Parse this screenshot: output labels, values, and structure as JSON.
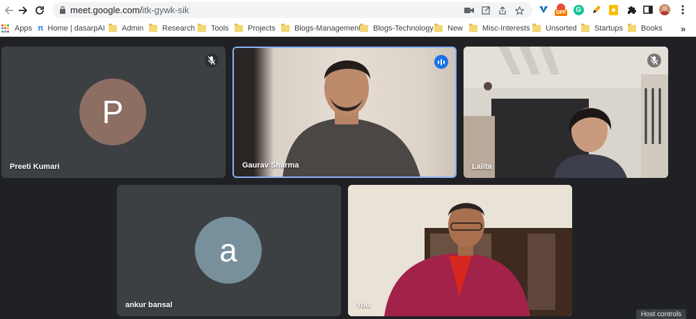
{
  "browser": {
    "url_host": "meet.google.com/",
    "url_path": "itk-gywk-sik",
    "ext_badge": "OFF",
    "more_bookmarks": "»"
  },
  "bookmarks": [
    {
      "label": "Apps",
      "type": "apps"
    },
    {
      "label": "Home | dasarpAI",
      "type": "site"
    },
    {
      "label": "Admin",
      "type": "folder"
    },
    {
      "label": "Research",
      "type": "folder"
    },
    {
      "label": "Tools",
      "type": "folder"
    },
    {
      "label": "Projects",
      "type": "folder"
    },
    {
      "label": "Blogs-Management",
      "type": "folder"
    },
    {
      "label": "Blogs-Technology",
      "type": "folder"
    },
    {
      "label": "New",
      "type": "folder"
    },
    {
      "label": "Misc-Interests",
      "type": "folder"
    },
    {
      "label": "Unsorted",
      "type": "folder"
    },
    {
      "label": "Startups",
      "type": "folder"
    },
    {
      "label": "Books",
      "type": "folder"
    }
  ],
  "participants": [
    {
      "name": "Preeti Kumari",
      "initial": "P",
      "avatar_color": "#8d6e63",
      "muted": true,
      "speaking": false
    },
    {
      "name": "Gaurav Sharma",
      "initial": "",
      "muted": false,
      "speaking": true
    },
    {
      "name": "Lalita",
      "initial": "",
      "muted": true,
      "speaking": false
    },
    {
      "name": "ankur bansal",
      "initial": "a",
      "avatar_color": "#78909c",
      "muted": false,
      "speaking": false
    },
    {
      "name": "You",
      "initial": "",
      "muted": false,
      "speaking": false
    }
  ],
  "host_controls": "Host controls",
  "colors": {
    "accent": "#8ab4f8",
    "speaking": "#1a73e8",
    "tile": "#3c4043",
    "background": "#202124"
  }
}
